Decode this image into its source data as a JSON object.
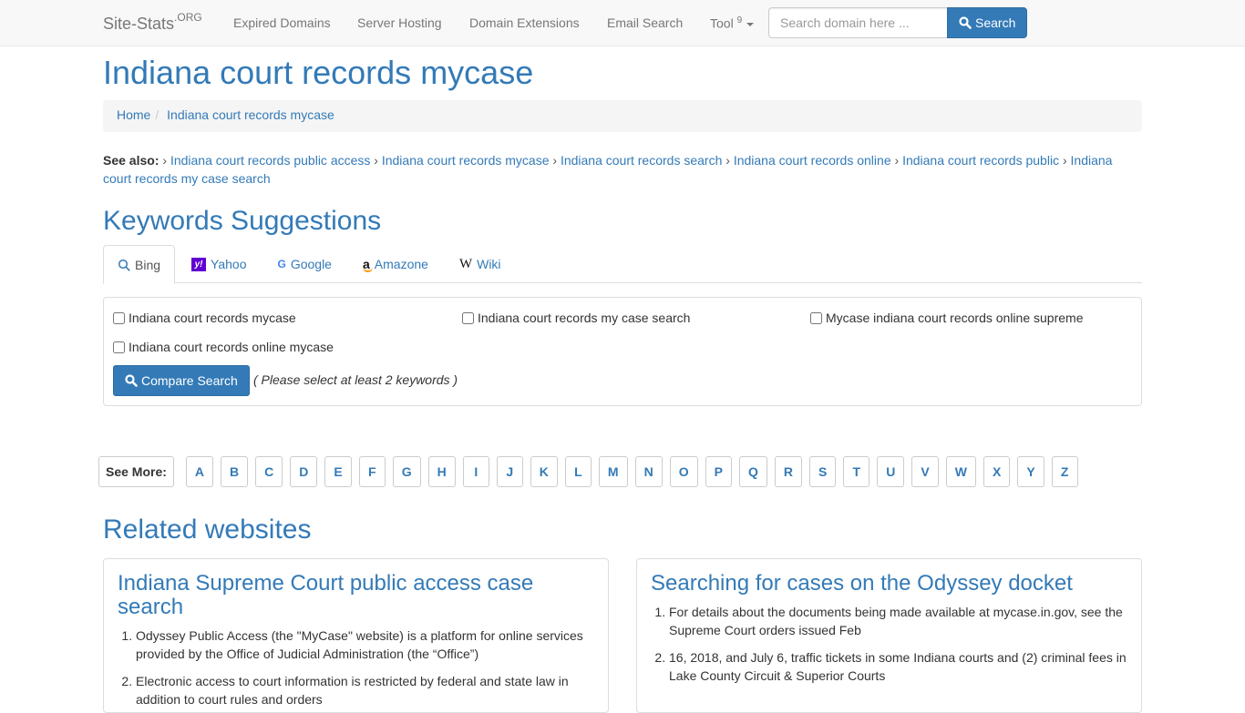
{
  "navbar": {
    "brand": "Site-Stats",
    "brand_sup": ".ORG",
    "links": [
      {
        "label": "Expired Domains"
      },
      {
        "label": "Server Hosting"
      },
      {
        "label": "Domain Extensions"
      },
      {
        "label": "Email Search"
      }
    ],
    "tool_label": "Tool",
    "tool_count": "9",
    "search_placeholder": "Search domain here ...",
    "search_button": "Search"
  },
  "page_title": "Indiana court records mycase",
  "breadcrumb": {
    "items": [
      {
        "label": "Home"
      },
      {
        "label": "Indiana court records mycase"
      }
    ],
    "separator": "/"
  },
  "see_also": {
    "label": "See also:",
    "links": [
      "Indiana court records public access",
      "Indiana court records mycase",
      "Indiana court records search",
      "Indiana court records online",
      "Indiana court records public",
      "Indiana court records my case search"
    ]
  },
  "keywords_section": {
    "title": "Keywords Suggestions",
    "tabs": [
      {
        "label": "Bing",
        "icon": "search-icon",
        "active": true
      },
      {
        "label": "Yahoo",
        "icon": "yahoo-icon",
        "active": false
      },
      {
        "label": "Google",
        "icon": "google-icon",
        "active": false
      },
      {
        "label": "Amazone",
        "icon": "amazon-icon",
        "active": false
      },
      {
        "label": "Wiki",
        "icon": "wikipedia-icon",
        "active": false
      }
    ],
    "keywords": [
      {
        "label": "Indiana court records mycase",
        "checked": false
      },
      {
        "label": "Indiana court records my case search",
        "checked": false
      },
      {
        "label": "Mycase indiana court records online supreme",
        "checked": false
      },
      {
        "label": "Indiana court records online mycase",
        "checked": false
      }
    ],
    "compare_button": "Compare Search",
    "compare_note": "( Please select at least 2 keywords )"
  },
  "see_more": {
    "label": "See More:",
    "letters": [
      "A",
      "B",
      "C",
      "D",
      "E",
      "F",
      "G",
      "H",
      "I",
      "J",
      "K",
      "L",
      "M",
      "N",
      "O",
      "P",
      "Q",
      "R",
      "S",
      "T",
      "U",
      "V",
      "W",
      "X",
      "Y",
      "Z"
    ]
  },
  "related": {
    "title": "Related websites",
    "cards": [
      {
        "title": "Indiana Supreme Court public access case search",
        "items": [
          "Odyssey Public Access (the \"MyCase\" website) is a platform for online services provided by the Office of Judicial Administration (the “Office”)",
          "Electronic access to court information is restricted by federal and state law in addition to court rules and orders"
        ]
      },
      {
        "title": "Searching for cases on the Odyssey docket",
        "items": [
          "For details about the documents being made available at mycase.in.gov, see the Supreme Court orders issued Feb",
          "16, 2018, and July 6, traffic tickets in some Indiana courts and (2) criminal fees in Lake County Circuit & Superior Courts"
        ]
      }
    ]
  }
}
